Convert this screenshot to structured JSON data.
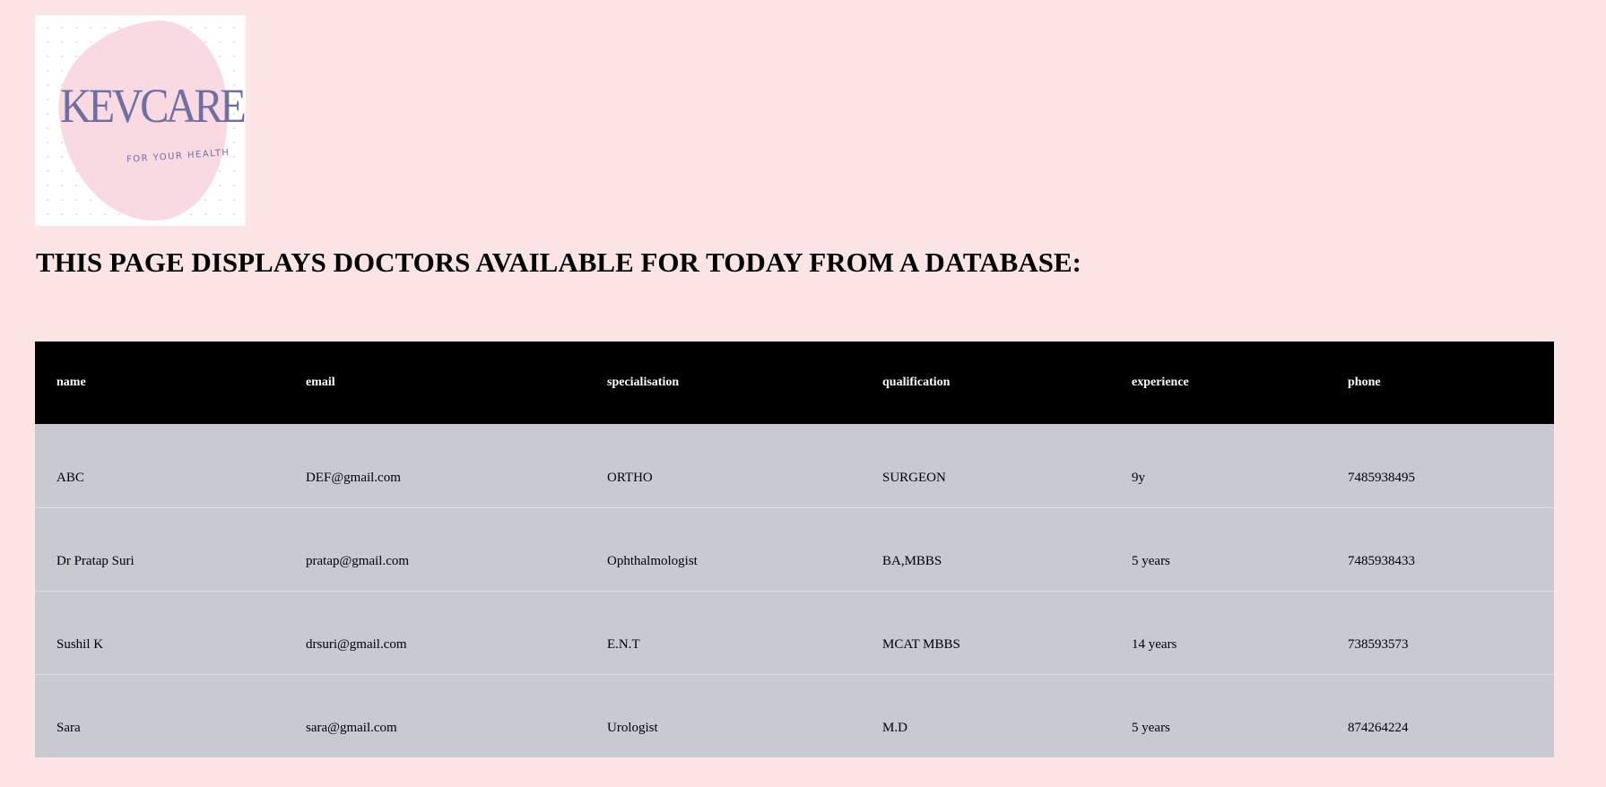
{
  "logo": {
    "brand": "KevCare",
    "brand_display": "KEVCARE",
    "tagline": "FOR YOUR HEALTH"
  },
  "heading": "THIS PAGE DISPLAYS DOCTORS AVAILABLE FOR TODAY FROM A DATABASE:",
  "table": {
    "columns": [
      "name",
      "email",
      "specialisation",
      "qualification",
      "experience",
      "phone"
    ],
    "rows": [
      [
        "ABC",
        "DEF@gmail.com",
        "ORTHO",
        "SURGEON",
        "9y",
        "7485938495"
      ],
      [
        "Dr Pratap Suri",
        "pratap@gmail.com",
        "Ophthalmologist",
        "BA,MBBS",
        "5 years",
        "7485938433"
      ],
      [
        "Sushil K",
        "drsuri@gmail.com",
        "E.N.T",
        "MCAT MBBS",
        "14 years",
        "738593573"
      ],
      [
        "Sara",
        "sara@gmail.com",
        "Urologist",
        "M.D",
        "5 years",
        "874264224"
      ]
    ]
  },
  "colors": {
    "page_background": "#fee5e5",
    "header_background": "#000000",
    "header_text": "#ffffff",
    "row_background": "#c9c9d1",
    "logo_text": "#6f6fa3",
    "logo_blob": "#f9d9e2"
  }
}
